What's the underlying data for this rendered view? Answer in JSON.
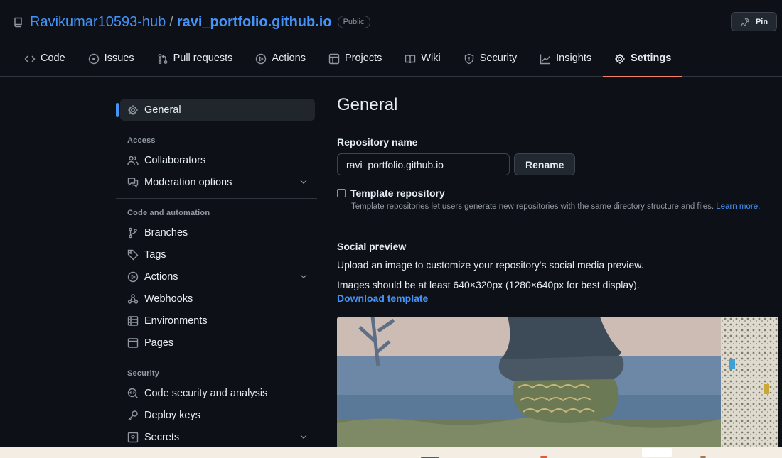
{
  "repo": {
    "owner": "Ravikumar10593-hub",
    "separator": "/",
    "name": "ravi_portfolio.github.io",
    "visibility": "Public",
    "pin_label": "Pin"
  },
  "tabs": [
    {
      "label": "Code",
      "icon": "code-icon"
    },
    {
      "label": "Issues",
      "icon": "issue-icon"
    },
    {
      "label": "Pull requests",
      "icon": "pull-request-icon"
    },
    {
      "label": "Actions",
      "icon": "play-icon"
    },
    {
      "label": "Projects",
      "icon": "table-icon"
    },
    {
      "label": "Wiki",
      "icon": "book-icon"
    },
    {
      "label": "Security",
      "icon": "shield-icon"
    },
    {
      "label": "Insights",
      "icon": "graph-icon"
    },
    {
      "label": "Settings",
      "icon": "gear-icon",
      "active": true
    }
  ],
  "sidebar": {
    "general": "General",
    "access_heading": "Access",
    "collaborators": "Collaborators",
    "moderation": "Moderation options",
    "code_heading": "Code and automation",
    "branches": "Branches",
    "tags": "Tags",
    "actions": "Actions",
    "webhooks": "Webhooks",
    "environments": "Environments",
    "pages": "Pages",
    "security_heading": "Security",
    "code_security": "Code security and analysis",
    "deploy_keys": "Deploy keys",
    "secrets": "Secrets"
  },
  "main": {
    "title": "General",
    "repo_name_label": "Repository name",
    "repo_name_value": "ravi_portfolio.github.io",
    "rename_button": "Rename",
    "template_label": "Template repository",
    "template_checked": false,
    "template_hint": "Template repositories let users generate new repositories with the same directory structure and files.",
    "learn_more": "Learn more.",
    "social_title": "Social preview",
    "social_desc": "Upload an image to customize your repository's social media preview.",
    "social_size": "Images should be at least 640×320px (1280×640px for best display).",
    "download_template": "Download template"
  },
  "colors": {
    "background": "#0d1117",
    "link": "#4493f8",
    "active_tab_underline": "#f78166",
    "taskbar": "#f4ede4"
  }
}
